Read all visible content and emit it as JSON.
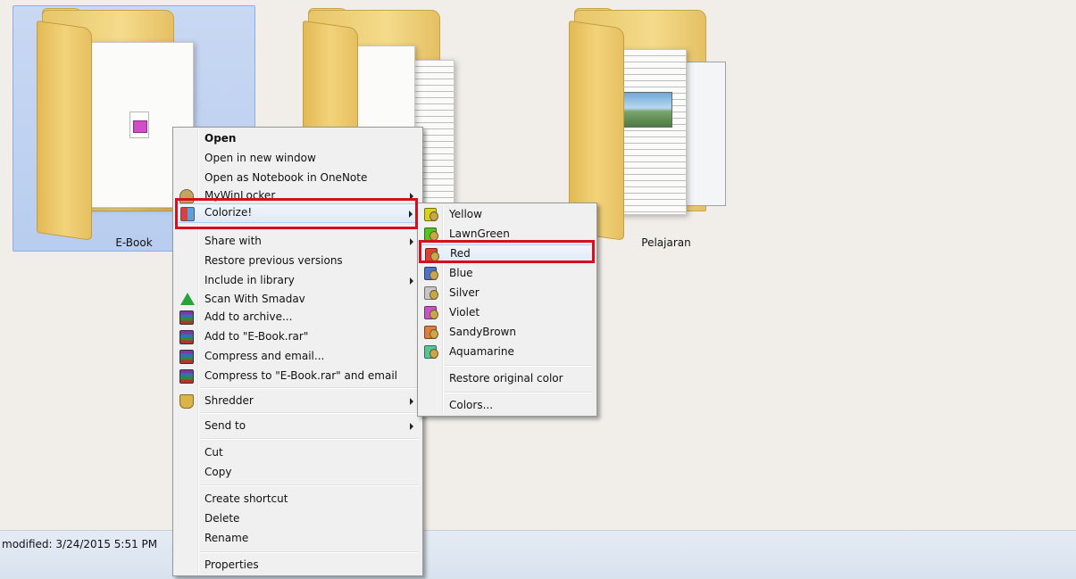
{
  "folders": [
    {
      "label": "E-Book",
      "selected": true
    },
    {
      "label": "",
      "selected": false
    },
    {
      "label": "Pelajaran",
      "selected": false
    }
  ],
  "details": {
    "modified_label": "modified:",
    "modified_value": "3/24/2015 5:51 PM"
  },
  "context_menu": {
    "items": [
      {
        "label": "Open"
      },
      {
        "label": "Open in new window"
      },
      {
        "label": "Open as Notebook in OneNote"
      },
      {
        "label": "MyWinLocker"
      },
      {
        "label": "Colorize!"
      },
      {
        "label": "Share with"
      },
      {
        "label": "Restore previous versions"
      },
      {
        "label": "Include in library"
      },
      {
        "label": "Scan With Smadav"
      },
      {
        "label": "Add to archive..."
      },
      {
        "label": "Add to \"E-Book.rar\""
      },
      {
        "label": "Compress and email..."
      },
      {
        "label": "Compress to \"E-Book.rar\" and email"
      },
      {
        "label": "Shredder"
      },
      {
        "label": "Send to"
      },
      {
        "label": "Cut"
      },
      {
        "label": "Copy"
      },
      {
        "label": "Create shortcut"
      },
      {
        "label": "Delete"
      },
      {
        "label": "Rename"
      },
      {
        "label": "Properties"
      }
    ]
  },
  "colorize_submenu": {
    "items": [
      {
        "label": "Yellow",
        "color": "#d8d21c"
      },
      {
        "label": "LawnGreen",
        "color": "#56c41f"
      },
      {
        "label": "Red",
        "color": "#d9432f"
      },
      {
        "label": "Blue",
        "color": "#4a73c9"
      },
      {
        "label": "Silver",
        "color": "#c6c6c6"
      },
      {
        "label": "Violet",
        "color": "#c656c6"
      },
      {
        "label": "SandyBrown",
        "color": "#e07d3c"
      },
      {
        "label": "Aquamarine",
        "color": "#56c69a"
      },
      {
        "label": "Restore original color"
      },
      {
        "label": "Colors..."
      }
    ]
  },
  "colors": {
    "highlight": "#d3101b",
    "selection": "#c9d8f3",
    "menu_bg": "#f0f0f0"
  }
}
